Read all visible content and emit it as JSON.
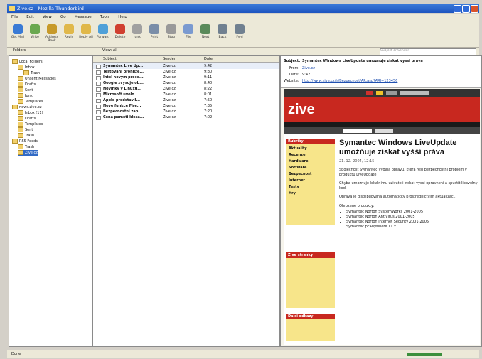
{
  "window": {
    "title": "Zive.cz - Mozilla Thunderbird"
  },
  "menu": [
    "File",
    "Edit",
    "View",
    "Go",
    "Message",
    "Tools",
    "Help"
  ],
  "toolbar": [
    "Get Mail",
    "Write",
    "Address Book",
    "Reply",
    "Reply All",
    "Forward",
    "Delete",
    "Junk",
    "Print",
    "Stop",
    "File",
    "Next",
    "Back",
    "Fwd"
  ],
  "address": {
    "label": "Folders",
    "view_label": "View: All"
  },
  "search": {
    "placeholder": "Subject or Sender"
  },
  "folders": [
    {
      "label": "Local Folders",
      "level": 0
    },
    {
      "label": "Inbox",
      "level": 1
    },
    {
      "label": "Trash",
      "level": 2
    },
    {
      "label": "Unsent Messages",
      "level": 1
    },
    {
      "label": "Drafts",
      "level": 1
    },
    {
      "label": "Sent",
      "level": 1
    },
    {
      "label": "Junk",
      "level": 1
    },
    {
      "label": "Templates",
      "level": 1
    },
    {
      "label": "news.zive.cz",
      "level": 0
    },
    {
      "label": "Inbox (11)",
      "level": 1
    },
    {
      "label": "Drafts",
      "level": 1
    },
    {
      "label": "Templates",
      "level": 1
    },
    {
      "label": "Sent",
      "level": 1
    },
    {
      "label": "Trash",
      "level": 1
    },
    {
      "label": "RSS Feeds",
      "level": 0
    },
    {
      "label": "Trash",
      "level": 1
    },
    {
      "label": "Zive.cz",
      "level": 1,
      "selected": true
    }
  ],
  "columns": [
    "Subject",
    "Sender",
    "Date"
  ],
  "messages": [
    {
      "subject": "Symantec Live Up...",
      "sender": "Zive.cz",
      "date": "9:42"
    },
    {
      "subject": "Testovani prohlize...",
      "sender": "Zive.cz",
      "date": "9:30"
    },
    {
      "subject": "Intel novym proce...",
      "sender": "Zive.cz",
      "date": "9:11"
    },
    {
      "subject": "Google zvysuje ob...",
      "sender": "Zive.cz",
      "date": "8:40"
    },
    {
      "subject": "Novinky v Linuxu...",
      "sender": "Zive.cz",
      "date": "8:22"
    },
    {
      "subject": "Microsoft uvoln...",
      "sender": "Zive.cz",
      "date": "8:01"
    },
    {
      "subject": "Apple predstavil...",
      "sender": "Zive.cz",
      "date": "7:50"
    },
    {
      "subject": "Nove funkce Fire...",
      "sender": "Zive.cz",
      "date": "7:35"
    },
    {
      "subject": "Bezpecnostni zap...",
      "sender": "Zive.cz",
      "date": "7:20"
    },
    {
      "subject": "Cena pameti klesa...",
      "sender": "Zive.cz",
      "date": "7:02"
    }
  ],
  "preview": {
    "subject_label": "Subject:",
    "subject": "Symantec Windows LiveUpdate umoznuje ziskat vyssi prava",
    "from_label": "From:",
    "from": "Zive.cz",
    "date_label": "Date:",
    "date": "9:42",
    "website_label": "Website:",
    "website": "http://www.zive.cz/h/Bezpecnost/AR.asp?ARI=123456"
  },
  "web": {
    "logo": "zive",
    "headline": "Symantec Windows LiveUpdate umožňuje získat vyšší práva",
    "byline": "21. 12. 2004, 12:15",
    "sidebar_title_1": "Rubriky",
    "sidebar_items": [
      "Aktuality",
      "Recenze",
      "Hardware",
      "Software",
      "Bezpecnost",
      "Internet",
      "Testy",
      "Hry"
    ],
    "sidebar_title_2": "Zive stranky",
    "sidebar_title_3": "Dalsi odkazy",
    "paragraphs": [
      "Spolecnost Symantec vydala opravu, ktera resi bezpecnostni problem v produktu LiveUpdate.",
      "Chyba umoznuje lokalnimu uzivateli ziskat vyssi opravneni a spustit libovolny kod.",
      "Oprava je distribuovana automaticky prostrednictvim aktualizaci."
    ],
    "list_title": "Ohrozene produkty:",
    "list": [
      "Symantec Norton SystemWorks 2001-2005",
      "Symantec Norton AntiVirus 2001-2005",
      "Symantec Norton Internet Security 2001-2005",
      "Symantec pcAnywhere 11.x"
    ]
  },
  "status": {
    "text": "Done"
  }
}
